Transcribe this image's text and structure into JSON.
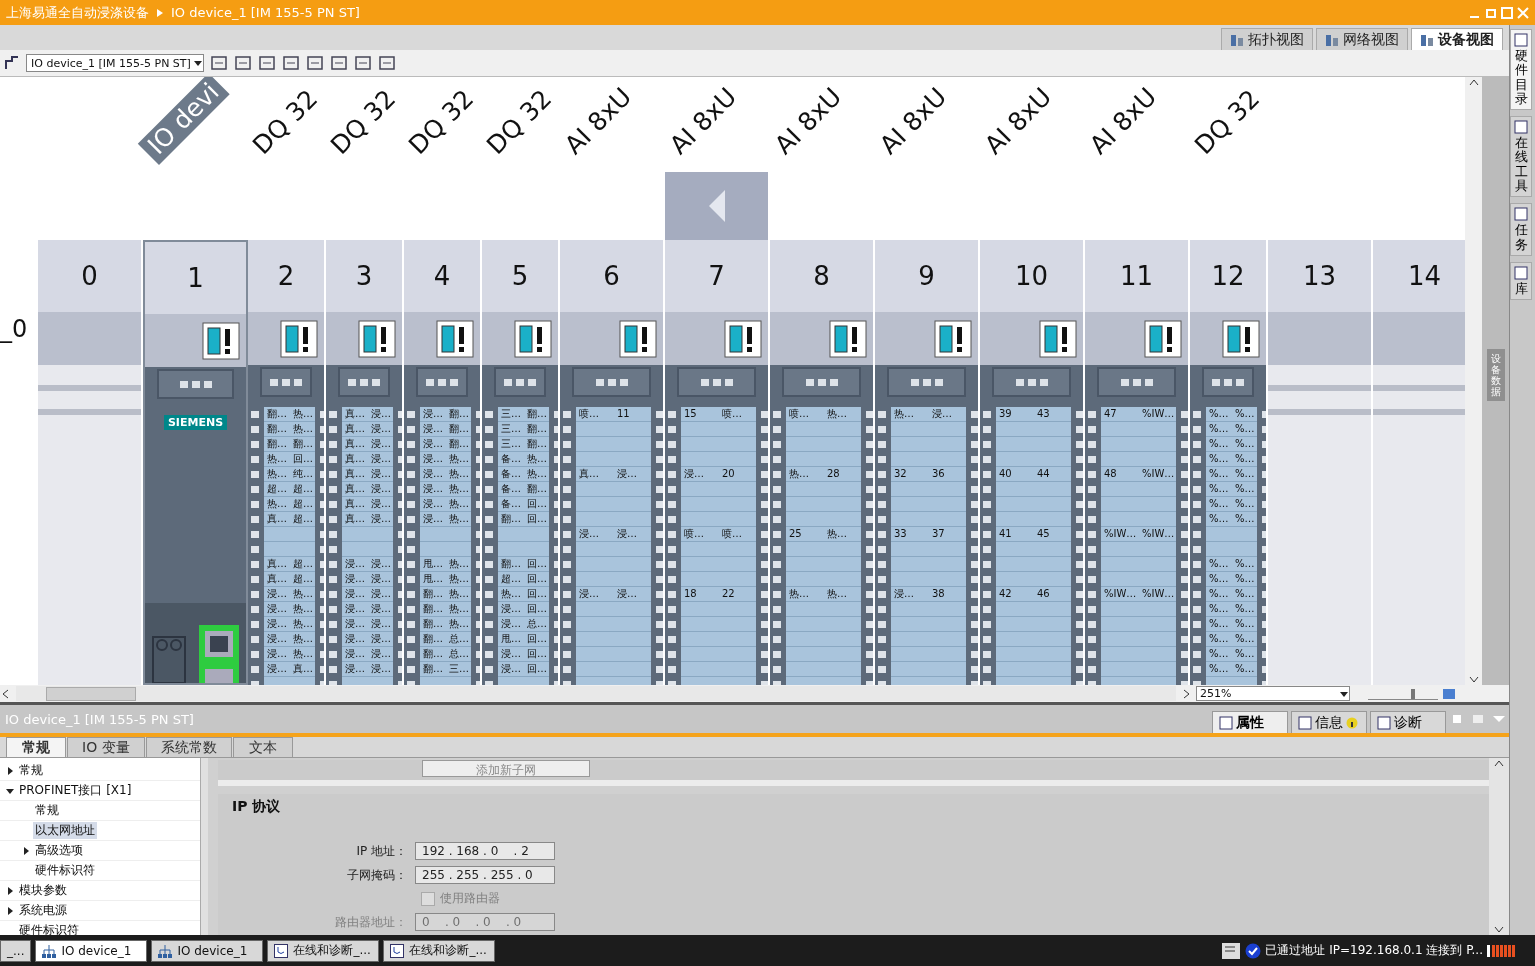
{
  "title_bar": {
    "project": "上海易通全自动浸涤设备",
    "device": "IO device_1 [IM 155-5 PN ST]"
  },
  "view_tabs": [
    {
      "label": "拓扑视图",
      "selected": false
    },
    {
      "label": "网络视图",
      "selected": false
    },
    {
      "label": "设备视图",
      "selected": true
    }
  ],
  "toolbar": {
    "device_select": "IO device_1 [IM 155-5 PN ST]"
  },
  "rack": {
    "name": "_0",
    "slots": [
      {
        "number": "0",
        "kind": "empty",
        "selected": false
      },
      {
        "number": "1",
        "label": "IO devi",
        "kind": "head",
        "brand": "SIEMENS",
        "selected": true
      },
      {
        "number": "2",
        "label": "DQ 32",
        "kind": "dq",
        "selected": false,
        "channels": [
          [
            "翻…",
            "热…"
          ],
          [
            "翻…",
            "热…"
          ],
          [
            "翻…",
            "翻…"
          ],
          [
            "热…",
            "回…"
          ],
          [
            "热…",
            "纯…"
          ],
          [
            "超…",
            "超…"
          ],
          [
            "热…",
            "超…"
          ],
          [
            "真…",
            "超…"
          ],
          [
            "真…",
            "超…"
          ],
          [
            "真…",
            "超…"
          ],
          [
            "浸…",
            "热…"
          ],
          [
            "浸…",
            "热…"
          ],
          [
            "浸…",
            "热…"
          ],
          [
            "浸…",
            "热…"
          ],
          [
            "浸…",
            "热…"
          ],
          [
            "浸…",
            "真…"
          ]
        ]
      },
      {
        "number": "3",
        "label": "DQ 32",
        "kind": "dq",
        "selected": false,
        "channels": [
          [
            "真…",
            "浸…"
          ],
          [
            "真…",
            "浸…"
          ],
          [
            "真…",
            "浸…"
          ],
          [
            "真…",
            "浸…"
          ],
          [
            "真…",
            "浸…"
          ],
          [
            "真…",
            "浸…"
          ],
          [
            "真…",
            "浸…"
          ],
          [
            "真…",
            "浸…"
          ],
          [
            "浸…",
            "浸…"
          ],
          [
            "浸…",
            "浸…"
          ],
          [
            "浸…",
            "浸…"
          ],
          [
            "浸…",
            "浸…"
          ],
          [
            "浸…",
            "浸…"
          ],
          [
            "浸…",
            "浸…"
          ],
          [
            "浸…",
            "浸…"
          ],
          [
            "浸…",
            "浸…"
          ]
        ]
      },
      {
        "number": "4",
        "label": "DQ 32",
        "kind": "dq",
        "selected": false,
        "channels": [
          [
            "浸…",
            "翻…"
          ],
          [
            "浸…",
            "翻…"
          ],
          [
            "浸…",
            "翻…"
          ],
          [
            "浸…",
            "热…"
          ],
          [
            "浸…",
            "热…"
          ],
          [
            "浸…",
            "热…"
          ],
          [
            "浸…",
            "热…"
          ],
          [
            "浸…",
            "热…"
          ],
          [
            "甩…",
            "热…"
          ],
          [
            "甩…",
            "热…"
          ],
          [
            "翻…",
            "热…"
          ],
          [
            "翻…",
            "热…"
          ],
          [
            "翻…",
            "热…"
          ],
          [
            "翻…",
            "总…"
          ],
          [
            "翻…",
            "总…"
          ],
          [
            "翻…",
            "三…"
          ]
        ]
      },
      {
        "number": "5",
        "label": "DQ 32",
        "kind": "dq",
        "selected": false,
        "channels": [
          [
            "三…",
            "翻…"
          ],
          [
            "三…",
            "翻…"
          ],
          [
            "三…",
            "翻…"
          ],
          [
            "备…",
            "热…"
          ],
          [
            "备…",
            "热…"
          ],
          [
            "备…",
            "翻…"
          ],
          [
            "备…",
            "回…"
          ],
          [
            "翻…",
            "回…"
          ],
          [
            "翻…",
            "回…"
          ],
          [
            "超…",
            "回…"
          ],
          [
            "热…",
            "回…"
          ],
          [
            "浸…",
            "回…"
          ],
          [
            "浸…",
            "总…"
          ],
          [
            "甩…",
            "回…"
          ],
          [
            "浸…",
            "回…"
          ],
          [
            "浸…",
            "回…"
          ]
        ]
      },
      {
        "number": "6",
        "label": "AI 8xU",
        "kind": "ai",
        "selected": false,
        "channels": [
          [
            "喷…",
            "11"
          ],
          [
            "真…",
            "浸…"
          ],
          [
            "浸…",
            "浸…"
          ],
          [
            "浸…",
            "浸…"
          ]
        ]
      },
      {
        "number": "7",
        "label": "AI 8xU",
        "kind": "ai",
        "selected": false,
        "channels": [
          [
            "15",
            "喷…"
          ],
          [
            "浸…",
            "20"
          ],
          [
            "喷…",
            "喷…"
          ],
          [
            "18",
            "22"
          ]
        ]
      },
      {
        "number": "8",
        "label": "AI 8xU",
        "kind": "ai",
        "selected": false,
        "channels": [
          [
            "喷…",
            "热…"
          ],
          [
            "热…",
            "28"
          ],
          [
            "25",
            "热…"
          ],
          [
            "热…",
            "热…"
          ]
        ]
      },
      {
        "number": "9",
        "label": "AI 8xU",
        "kind": "ai",
        "selected": false,
        "channels": [
          [
            "热…",
            "浸…"
          ],
          [
            "32",
            "36"
          ],
          [
            "33",
            "37"
          ],
          [
            "浸…",
            "38"
          ]
        ]
      },
      {
        "number": "10",
        "label": "AI 8xU",
        "kind": "ai",
        "selected": false,
        "channels": [
          [
            "39",
            "43"
          ],
          [
            "40",
            "44"
          ],
          [
            "41",
            "45"
          ],
          [
            "42",
            "46"
          ]
        ]
      },
      {
        "number": "11",
        "label": "AI 8xU",
        "kind": "ai",
        "selected": false,
        "channels": [
          [
            "47",
            "%IW…"
          ],
          [
            "48",
            "%IW…"
          ],
          [
            "%IW…",
            "%IW…"
          ],
          [
            "%IW…",
            "%IW…"
          ]
        ]
      },
      {
        "number": "12",
        "label": "DQ 32",
        "kind": "dq",
        "selected": false,
        "channels": [
          [
            "%…",
            "%…"
          ],
          [
            "%…",
            "%…"
          ],
          [
            "%…",
            "%…"
          ],
          [
            "%…",
            "%…"
          ],
          [
            "%…",
            "%…"
          ],
          [
            "%…",
            "%…"
          ],
          [
            "%…",
            "%…"
          ],
          [
            "%…",
            "%…"
          ],
          [
            "%…",
            "%…"
          ],
          [
            "%…",
            "%…"
          ],
          [
            "%…",
            "%…"
          ],
          [
            "%…",
            "%…"
          ],
          [
            "%…",
            "%…"
          ],
          [
            "%…",
            "%…"
          ],
          [
            "%…",
            "%…"
          ],
          [
            "%…",
            "%…"
          ]
        ]
      },
      {
        "number": "13",
        "kind": "empty",
        "selected": false
      },
      {
        "number": "14",
        "kind": "empty",
        "selected": false
      }
    ]
  },
  "zoom": "251%",
  "zoom_slider": {
    "level": 0.64
  },
  "device_data_tab": "设备数据",
  "side_tabs": [
    {
      "label": "硬件目录",
      "selected": true
    },
    {
      "label": "在线工具",
      "selected": false
    },
    {
      "label": "任务",
      "selected": false
    },
    {
      "label": "库",
      "selected": false
    }
  ],
  "inspector": {
    "title": "IO device_1 [IM 155-5 PN ST]",
    "panel_tabs": [
      {
        "label": "属性",
        "selected": true
      },
      {
        "label": "信息",
        "selected": false
      },
      {
        "label": "诊断",
        "selected": false
      }
    ],
    "tabs": [
      {
        "label": "常规",
        "selected": true
      },
      {
        "label": "IO 变量",
        "selected": false
      },
      {
        "label": "系统常数",
        "selected": false
      },
      {
        "label": "文本",
        "selected": false
      }
    ],
    "tree": [
      {
        "label": "常规",
        "expanded": false,
        "selected": false
      },
      {
        "label": "PROFINET接口 [X1]",
        "expanded": true,
        "selected": false,
        "children": [
          {
            "label": "常规",
            "selected": false
          },
          {
            "label": "以太网地址",
            "selected": true
          },
          {
            "label": "高级选项",
            "expanded": false,
            "selected": false
          },
          {
            "label": "硬件标识符",
            "selected": false
          }
        ]
      },
      {
        "label": "模块参数",
        "expanded": false,
        "selected": false
      },
      {
        "label": "系统电源",
        "expanded": false,
        "selected": false
      },
      {
        "label": "硬件标识符",
        "selected": false
      }
    ],
    "add_subnet_button": "添加新子网",
    "section_title": "IP 协议",
    "ip_fields": [
      {
        "label": "IP 地址：",
        "value": "192 . 168 . 0    . 2",
        "disabled": false
      },
      {
        "label": "子网掩码：",
        "value": "255 . 255 . 255 . 0",
        "disabled": false
      }
    ],
    "router_checkbox": {
      "label": "使用路由器",
      "checked": false,
      "disabled": true
    },
    "router_field": {
      "label": "路由器地址：",
      "value": "0    . 0    . 0    . 0",
      "disabled": true
    }
  },
  "taskbar": {
    "items": [
      {
        "label": "_...",
        "kind": "other",
        "selected": false
      },
      {
        "label": "IO device_1",
        "kind": "device",
        "selected": true
      },
      {
        "label": "IO device_1",
        "kind": "device",
        "selected": false
      },
      {
        "label": "在线和诊断_...",
        "kind": "diagnostics",
        "selected": false
      },
      {
        "label": "在线和诊断_...",
        "kind": "diagnostics",
        "selected": false
      }
    ],
    "status": "已通过地址 IP=192.168.0.1 连接到 P..."
  }
}
